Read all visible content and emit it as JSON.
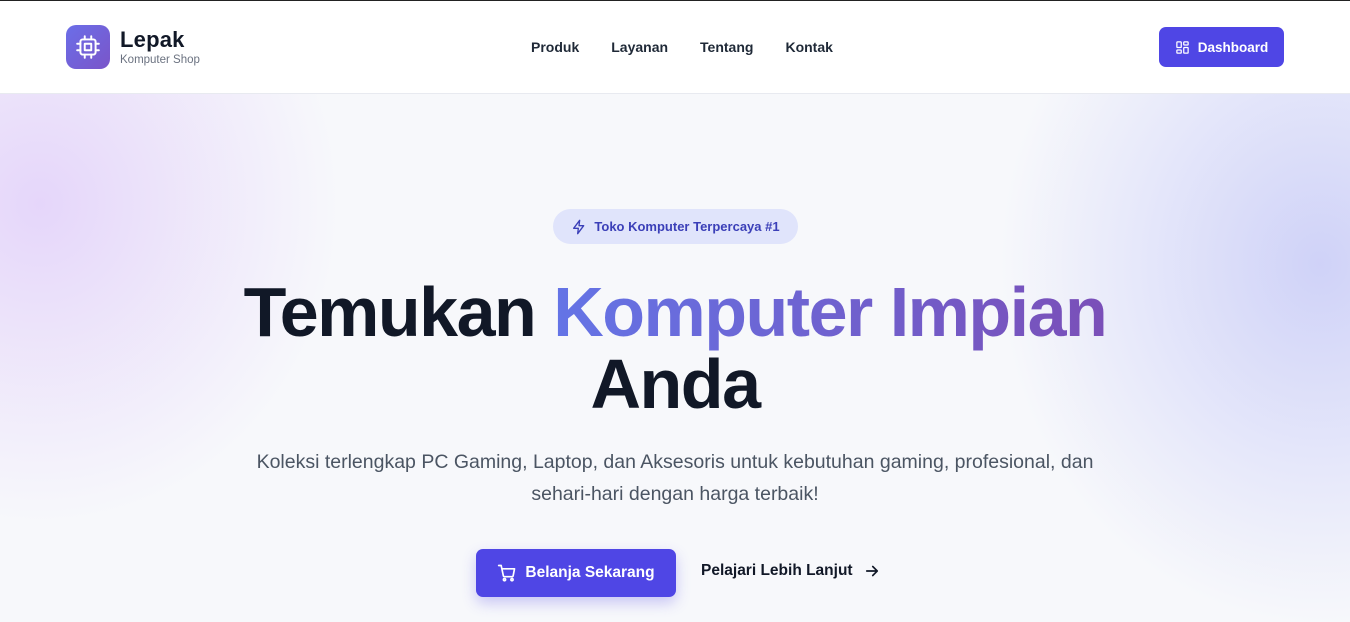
{
  "brand": {
    "name": "Lepak",
    "tagline": "Komputer Shop",
    "logo_icon": "cpu-icon"
  },
  "nav": {
    "items": [
      {
        "label": "Produk"
      },
      {
        "label": "Layanan"
      },
      {
        "label": "Tentang"
      },
      {
        "label": "Kontak"
      }
    ]
  },
  "header": {
    "dashboard_label": "Dashboard",
    "dashboard_icon": "grid-icon"
  },
  "hero": {
    "badge": "Toko Komputer Terpercaya #1",
    "badge_icon": "lightning-icon",
    "title_start": "Temukan",
    "title_highlight": "Komputer Impian",
    "title_end": "Anda",
    "description": "Koleksi terlengkap PC Gaming, Laptop, dan Aksesoris untuk kebutuhan gaming, profesional, dan sehari-hari dengan harga terbaik!",
    "primary_cta": "Belanja Sekarang",
    "primary_cta_icon": "cart-icon",
    "secondary_cta": "Pelajari Lebih Lanjut",
    "secondary_cta_icon": "arrow-right-icon"
  },
  "colors": {
    "accent": "#4f46e5",
    "gradient_start": "#6474e6",
    "gradient_end": "#7a4fb8",
    "text_dark": "#111827",
    "text_muted": "#4b5563"
  }
}
